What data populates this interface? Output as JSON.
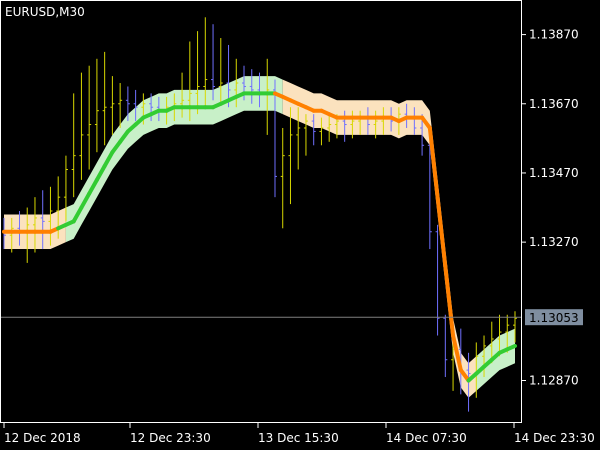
{
  "title": "EURUSD,M30",
  "colors": {
    "background": "#000000",
    "axis": "#ffffff",
    "price_line": "#7f7f7f",
    "price_badge": "#7f8ea0",
    "bar_up": "#d8d800",
    "bar_down": "#7070ff",
    "band_up_fill": "#c8f0c8",
    "band_down_fill": "#fbe2be",
    "line_up": "#33cc33",
    "line_down": "#ff8000"
  },
  "chart_data": {
    "type": "line",
    "title": "EURUSD,M30",
    "ylim": [
      1.1275,
      1.1397
    ],
    "y_ticks": [
      "1.13870",
      "1.13670",
      "1.13470",
      "1.13270",
      "1.12870"
    ],
    "y_tick_values": [
      1.1387,
      1.1367,
      1.1347,
      1.1327,
      1.1287
    ],
    "x_ticks": [
      "12 Dec 2018",
      "12 Dec 23:30",
      "13 Dec 15:30",
      "14 Dec 07:30",
      "14 Dec 23:30"
    ],
    "current_price": "1.13053",
    "current_price_value": 1.13053,
    "grid": false,
    "middle_line": [
      1.133,
      1.133,
      1.133,
      1.133,
      1.133,
      1.133,
      1.133,
      1.1331,
      1.1332,
      1.1333,
      1.1337,
      1.1341,
      1.1345,
      1.1349,
      1.1353,
      1.1356,
      1.1359,
      1.1361,
      1.1363,
      1.1364,
      1.1365,
      1.1365,
      1.1366,
      1.1366,
      1.1366,
      1.1366,
      1.1366,
      1.1366,
      1.1367,
      1.1368,
      1.1369,
      1.137,
      1.137,
      1.137,
      1.137,
      1.137,
      1.1369,
      1.1368,
      1.1367,
      1.1366,
      1.1365,
      1.1365,
      1.1364,
      1.1363,
      1.1363,
      1.1363,
      1.1363,
      1.1363,
      1.1363,
      1.1363,
      1.1363,
      1.1362,
      1.1363,
      1.1363,
      1.1363,
      1.136,
      1.134,
      1.132,
      1.13,
      1.129,
      1.1287,
      1.1289,
      1.1291,
      1.1293,
      1.1295,
      1.1296,
      1.1297
    ],
    "trend": [
      "down",
      "down",
      "down",
      "down",
      "down",
      "down",
      "down",
      "down",
      "up",
      "up",
      "up",
      "up",
      "up",
      "up",
      "up",
      "up",
      "up",
      "up",
      "up",
      "up",
      "up",
      "up",
      "up",
      "up",
      "up",
      "up",
      "up",
      "up",
      "up",
      "up",
      "up",
      "up",
      "up",
      "up",
      "up",
      "up",
      "down",
      "down",
      "down",
      "down",
      "down",
      "down",
      "down",
      "down",
      "down",
      "down",
      "down",
      "down",
      "down",
      "down",
      "down",
      "down",
      "down",
      "down",
      "down",
      "down",
      "down",
      "down",
      "down",
      "down",
      "down",
      "up",
      "up",
      "up",
      "up",
      "up",
      "up"
    ],
    "band_width": 0.0005,
    "ohlc": [
      [
        1.133,
        1.1334,
        1.1325,
        1.1329
      ],
      [
        1.1329,
        1.1334,
        1.1324,
        1.1331
      ],
      [
        1.1331,
        1.1336,
        1.1326,
        1.133
      ],
      [
        1.133,
        1.1337,
        1.1321,
        1.1332
      ],
      [
        1.1332,
        1.134,
        1.1324,
        1.1334
      ],
      [
        1.1334,
        1.1342,
        1.1325,
        1.1333
      ],
      [
        1.1333,
        1.1343,
        1.1326,
        1.1336
      ],
      [
        1.1336,
        1.1346,
        1.1328,
        1.134
      ],
      [
        1.134,
        1.1352,
        1.1333,
        1.1348
      ],
      [
        1.1348,
        1.137,
        1.134,
        1.1352
      ],
      [
        1.1352,
        1.1376,
        1.1345,
        1.1358
      ],
      [
        1.1358,
        1.1378,
        1.1348,
        1.1361
      ],
      [
        1.1361,
        1.138,
        1.1353,
        1.1365
      ],
      [
        1.1365,
        1.1382,
        1.1355,
        1.1366
      ],
      [
        1.1366,
        1.1375,
        1.1358,
        1.1367
      ],
      [
        1.1367,
        1.1373,
        1.136,
        1.1368
      ],
      [
        1.1368,
        1.1372,
        1.1362,
        1.1367
      ],
      [
        1.1367,
        1.1371,
        1.1362,
        1.1366
      ],
      [
        1.1366,
        1.137,
        1.1361,
        1.1367
      ],
      [
        1.1367,
        1.137,
        1.1362,
        1.1366
      ],
      [
        1.1366,
        1.1369,
        1.1362,
        1.1365
      ],
      [
        1.1365,
        1.1369,
        1.1361,
        1.1366
      ],
      [
        1.1366,
        1.137,
        1.1362,
        1.1367
      ],
      [
        1.1367,
        1.1376,
        1.1363,
        1.1368
      ],
      [
        1.1368,
        1.1385,
        1.1362,
        1.137
      ],
      [
        1.137,
        1.1388,
        1.1364,
        1.1372
      ],
      [
        1.1372,
        1.1392,
        1.1366,
        1.1374
      ],
      [
        1.1374,
        1.139,
        1.1368,
        1.1372
      ],
      [
        1.1372,
        1.1386,
        1.1367,
        1.1373
      ],
      [
        1.1373,
        1.1384,
        1.1366,
        1.1371
      ],
      [
        1.1371,
        1.138,
        1.1366,
        1.1373
      ],
      [
        1.1373,
        1.1378,
        1.1368,
        1.1372
      ],
      [
        1.1372,
        1.1377,
        1.1367,
        1.1371
      ],
      [
        1.1371,
        1.1376,
        1.1366,
        1.137
      ],
      [
        1.137,
        1.138,
        1.1358,
        1.1371
      ],
      [
        1.1371,
        1.1374,
        1.134,
        1.1346
      ],
      [
        1.1346,
        1.136,
        1.1331,
        1.1352
      ],
      [
        1.1352,
        1.1366,
        1.1338,
        1.1358
      ],
      [
        1.1358,
        1.1366,
        1.1348,
        1.136
      ],
      [
        1.136,
        1.1364,
        1.1352,
        1.1362
      ],
      [
        1.1362,
        1.1364,
        1.1355,
        1.1359
      ],
      [
        1.1359,
        1.1363,
        1.1355,
        1.136
      ],
      [
        1.136,
        1.1364,
        1.1356,
        1.1361
      ],
      [
        1.1361,
        1.1364,
        1.1357,
        1.1362
      ],
      [
        1.1362,
        1.1365,
        1.1356,
        1.1361
      ],
      [
        1.1361,
        1.1365,
        1.1357,
        1.1362
      ],
      [
        1.1362,
        1.1365,
        1.1358,
        1.1363
      ],
      [
        1.1363,
        1.1366,
        1.1358,
        1.1361
      ],
      [
        1.1361,
        1.1365,
        1.1357,
        1.1362
      ],
      [
        1.1362,
        1.1366,
        1.1358,
        1.1363
      ],
      [
        1.1363,
        1.1366,
        1.1359,
        1.1362
      ],
      [
        1.1362,
        1.1366,
        1.1358,
        1.1364
      ],
      [
        1.1364,
        1.1367,
        1.136,
        1.1363
      ],
      [
        1.1363,
        1.1366,
        1.1358,
        1.136
      ],
      [
        1.136,
        1.1364,
        1.1352,
        1.1355
      ],
      [
        1.1355,
        1.1356,
        1.1325,
        1.133
      ],
      [
        1.133,
        1.1332,
        1.13,
        1.1305
      ],
      [
        1.1305,
        1.1306,
        1.1288,
        1.1293
      ],
      [
        1.1293,
        1.13,
        1.1284,
        1.1296
      ],
      [
        1.1296,
        1.1302,
        1.1283,
        1.129
      ],
      [
        1.129,
        1.1295,
        1.1278,
        1.1289
      ],
      [
        1.1289,
        1.1298,
        1.1282,
        1.1294
      ],
      [
        1.1294,
        1.13,
        1.1288,
        1.1297
      ],
      [
        1.1297,
        1.1304,
        1.1292,
        1.1299
      ],
      [
        1.1299,
        1.1306,
        1.1294,
        1.1301
      ],
      [
        1.1301,
        1.1306,
        1.1295,
        1.1303
      ],
      [
        1.1303,
        1.1307,
        1.1298,
        1.1305
      ]
    ]
  }
}
